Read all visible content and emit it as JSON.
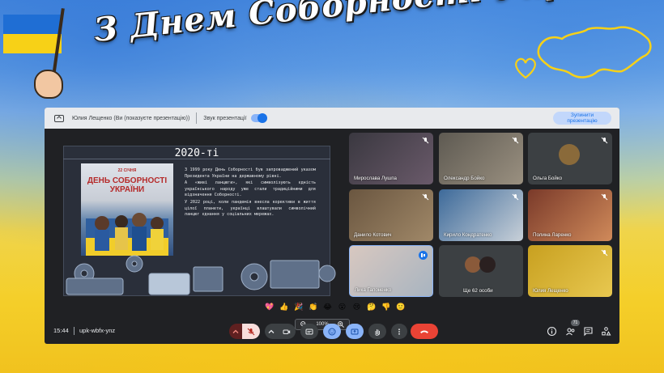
{
  "headline": "З Днем Соборності України!!!",
  "meet": {
    "topbar": {
      "presenter": "Юлия Лещенко (Ви (показуєте презентацію))",
      "sound_label": "Звук презентації",
      "stop_line1": "Зупинити",
      "stop_line2": "презентацію"
    },
    "slide": {
      "title": "2020-ті",
      "poster_small": "22 СІЧНЯ",
      "poster_big": "ДЕНЬ СОБОРНОСТІ УКРАЇНИ",
      "paragraphs": [
        "З 1999 року День Соборності був запроваджений указом Президента України на державному рівні.",
        "А «живі ланцюги», які символізують єдність українського народу уже стали традиційними для відзначення Соборності.",
        "У 2022 році, коли пандемія внесла корективи в життя цілої планети, українці влаштували символічний ланцюг єднання у соціальних мережах."
      ],
      "zoom": "100%"
    },
    "tiles": [
      {
        "name": "Мирослава Лушпа",
        "muted": true
      },
      {
        "name": "Олександр Бойко",
        "muted": true
      },
      {
        "name": "Ольга Бойко",
        "muted": true
      },
      {
        "name": "Данило Котович",
        "muted": true
      },
      {
        "name": "Кирило Кондратенко",
        "muted": true
      },
      {
        "name": "Полина Ларенко",
        "muted": true
      },
      {
        "name": "Лика Гапоненко",
        "muted": false,
        "speaking": true
      },
      {
        "name": "Ще 62 особи",
        "muted": false
      },
      {
        "name": "Юлия Лещенко",
        "muted": true
      }
    ],
    "reactions": [
      "💖",
      "👍",
      "🎉",
      "👏",
      "😂",
      "😮",
      "😢",
      "🤔",
      "👎",
      "🙂"
    ],
    "bottom": {
      "time": "15:44",
      "code": "upk-wbfx-ynz",
      "participants_badge": "71"
    },
    "colors": {
      "accent": "#8ab4f8",
      "end_call": "#ea4335",
      "muted_bg": "#f9dedc"
    }
  }
}
